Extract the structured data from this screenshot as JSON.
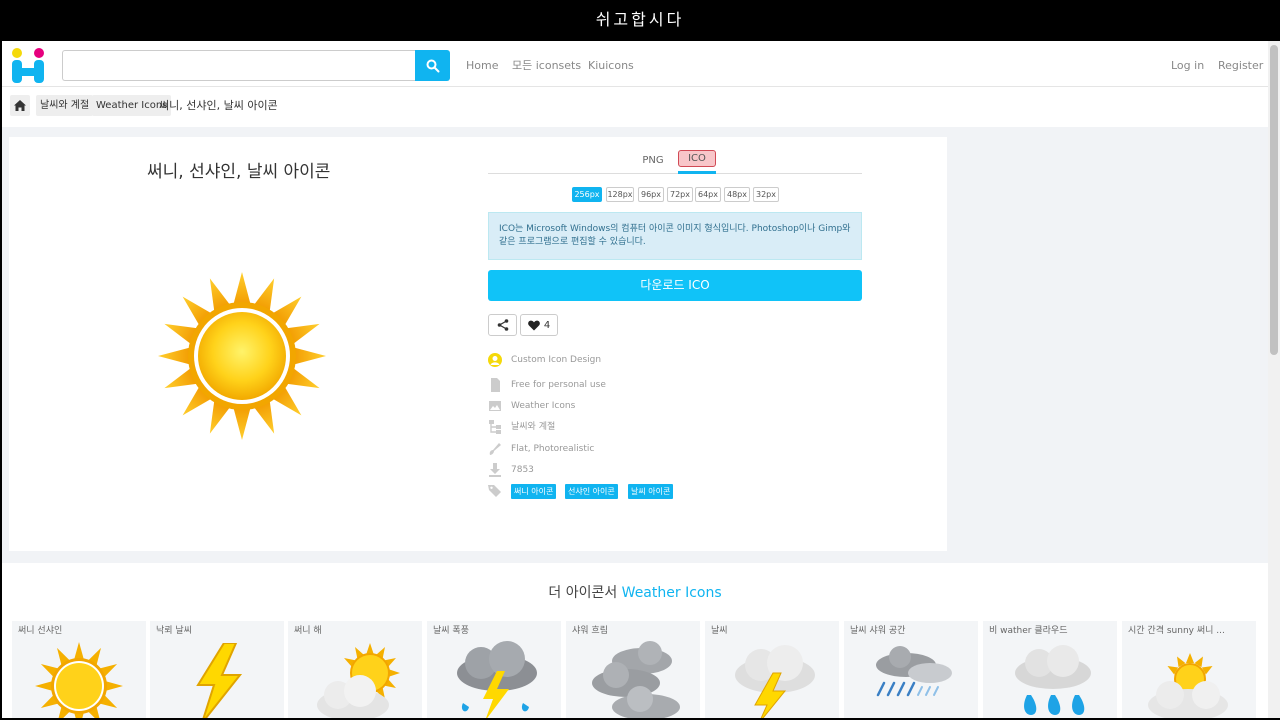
{
  "window_title": "쉬고합시다",
  "header": {
    "search_placeholder": "",
    "nav": [
      "Home",
      "모든 iconsets",
      "Kiuicons"
    ],
    "auth": [
      "Log in",
      "Register"
    ]
  },
  "breadcrumb": {
    "items": [
      "날씨와 계절",
      "Weather Icons"
    ],
    "current": "써니, 선샤인, 날씨 아이콘"
  },
  "icon": {
    "title": "써니, 선샤인, 날씨 아이콘",
    "formats": [
      "PNG",
      "ICO"
    ],
    "active_format": "ICO",
    "sizes": [
      "256px",
      "128px",
      "96px",
      "72px",
      "64px",
      "48px",
      "32px"
    ],
    "active_size": "256px",
    "info": "ICO는 Microsoft Windows의 컴퓨터 아이콘 이미지 형식입니다. Photoshop이나 Gimp와 같은 프로그램으로 편집할 수 있습니다.",
    "download_label": "다운로드 ICO",
    "like_count": "4",
    "author": "Custom Icon Design",
    "license": "Free for personal use",
    "iconset": "Weather Icons",
    "category": "날씨와 계절",
    "style": "Flat, Photorealistic",
    "downloads": "7853",
    "tags": [
      "써니 아이콘",
      "선샤인 아이콘",
      "날씨 아이콘"
    ]
  },
  "more": {
    "prefix": "더 아이콘서",
    "set_name": "Weather Icons",
    "items": [
      {
        "label": "써니 선샤인",
        "icon": "sun-icon"
      },
      {
        "label": "낙뢰 날씨",
        "icon": "lightning-icon"
      },
      {
        "label": "써니 해",
        "icon": "sun-cloud-icon"
      },
      {
        "label": "날씨 폭풍",
        "icon": "storm-icon"
      },
      {
        "label": "샤워 흐림",
        "icon": "clouds-icon"
      },
      {
        "label": "날씨",
        "icon": "thunder-cloud-icon"
      },
      {
        "label": "날씨 샤워 공간",
        "icon": "rain-cloud-icon"
      },
      {
        "label": "비 wather 클라우드",
        "icon": "rain-drops-icon"
      },
      {
        "label": "시간 간격 sunny 써니 ...",
        "icon": "partly-sunny-icon"
      }
    ]
  },
  "colors": {
    "accent": "#10b4f0",
    "download": "#10c3f8",
    "sun": "#f5b800"
  }
}
